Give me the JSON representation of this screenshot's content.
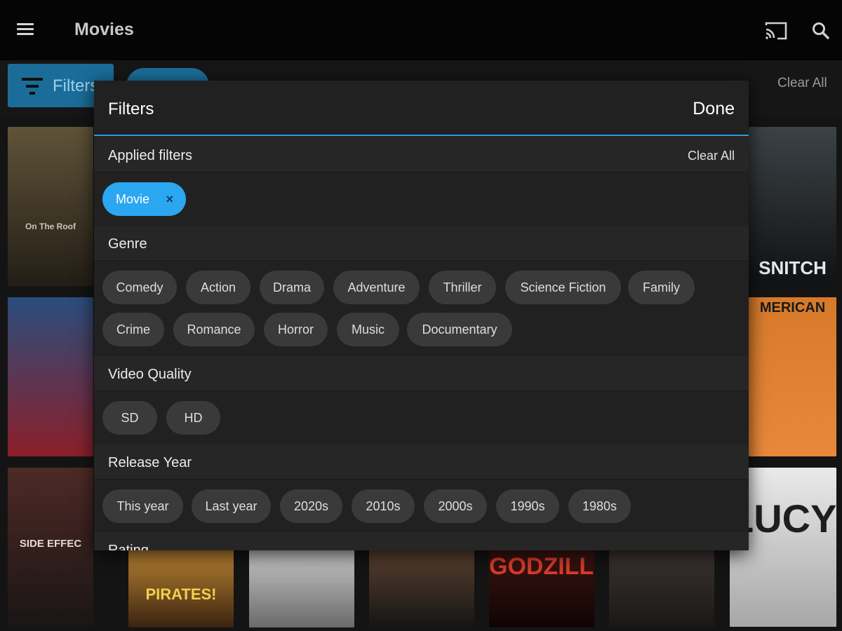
{
  "appbar": {
    "title": "Movies",
    "menu_icon": "menu-icon",
    "cast_icon": "cast-icon",
    "search_icon": "search-icon"
  },
  "filterbar": {
    "filters_label": "Filters",
    "clear_all_label": "Clear All"
  },
  "posters": [
    {
      "text": "On The Roof",
      "color_top": "#5f5339",
      "color_bottom": "#231e16"
    },
    {
      "text": "",
      "color_top": "#2a4d7c",
      "color_bottom": "#8b1f2a"
    },
    {
      "text": "SIDE EFFEC",
      "color_top": "#4d2a26",
      "color_bottom": "#1a1515"
    },
    {
      "text": "SNITCH",
      "color_top": "#3c4246",
      "color_bottom": "#101214"
    },
    {
      "text": "MERICAN",
      "color_top": "#d67a2a",
      "color_bottom": "#e8893a"
    },
    {
      "text": "LUCY",
      "color_top": "#eaeaea",
      "color_bottom": "#a7a7a7"
    },
    {
      "text": "PIRATES!",
      "color_top": "#b98432",
      "color_bottom": "#3b2310"
    },
    {
      "text": "",
      "color_top": "#c8c8c8",
      "color_bottom": "#6a6a6a"
    },
    {
      "text": "",
      "color_top": "#5a4030",
      "color_bottom": "#151515"
    },
    {
      "text": "GODZILLA",
      "color_top": "#3a1410",
      "color_bottom": "#100404"
    },
    {
      "text": "",
      "color_top": "#3a3230",
      "color_bottom": "#1a1816"
    }
  ],
  "panel": {
    "title": "Filters",
    "done_label": "Done",
    "applied": {
      "title": "Applied filters",
      "clear_all": "Clear All",
      "chips": [
        {
          "label": "Movie",
          "remove": "×"
        }
      ]
    },
    "genre": {
      "title": "Genre",
      "row1": [
        "Comedy",
        "Action",
        "Drama",
        "Adventure",
        "Thriller",
        "Science Fiction",
        "Family"
      ],
      "row2": [
        "Crime",
        "Romance",
        "Horror",
        "Music",
        "Documentary"
      ]
    },
    "quality": {
      "title": "Video Quality",
      "chips": [
        "SD",
        "HD"
      ]
    },
    "year": {
      "title": "Release Year",
      "chips": [
        "This year",
        "Last year",
        "2020s",
        "2010s",
        "2000s",
        "1990s",
        "1980s"
      ]
    },
    "rating": {
      "title": "Rating"
    }
  },
  "colors": {
    "accent": "#2aa7f0",
    "accent_dark": "#1b6c99",
    "chip": "#3a3a3a",
    "panel": "#212121"
  }
}
